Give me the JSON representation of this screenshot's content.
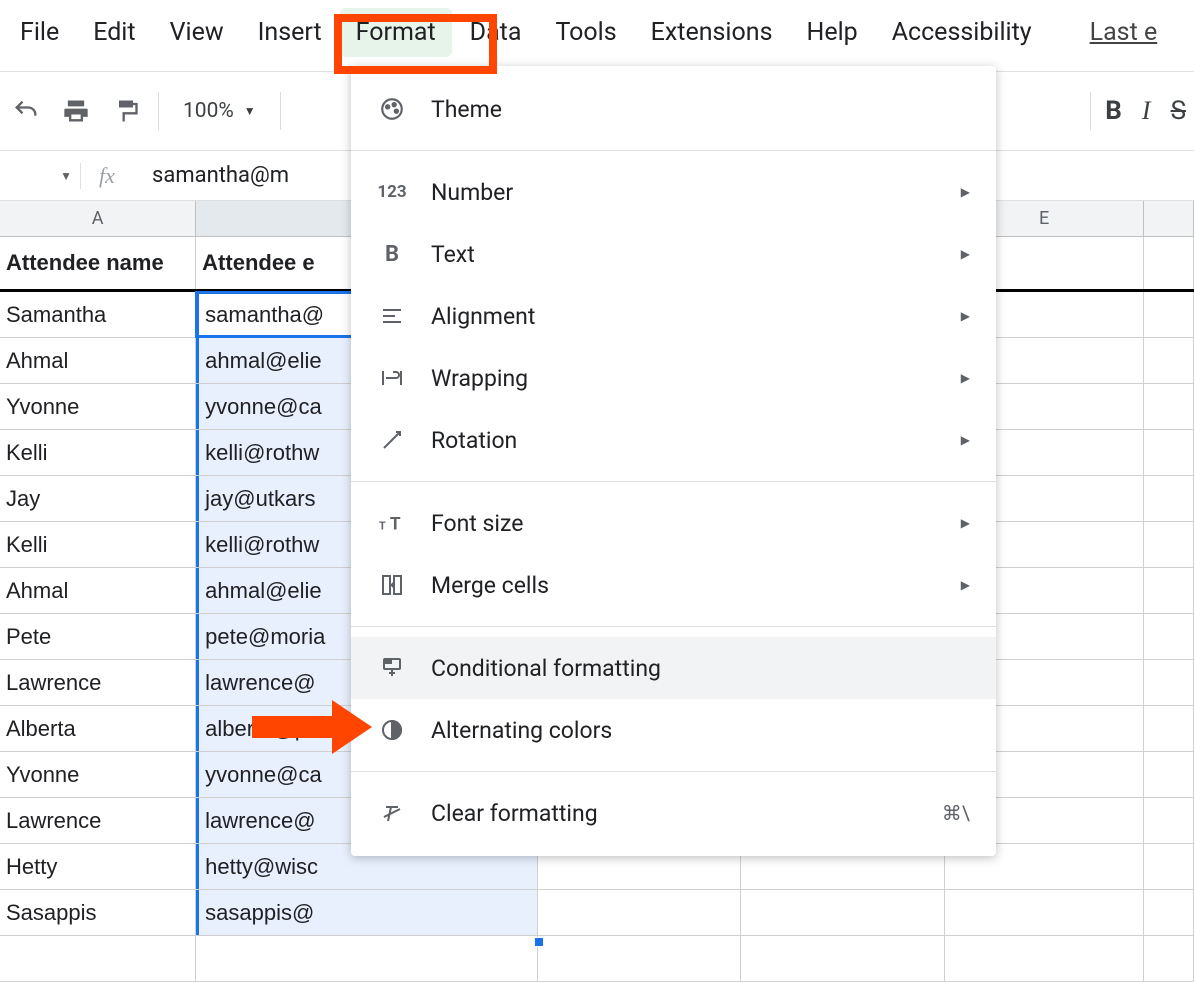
{
  "menubar": {
    "file": "File",
    "edit": "Edit",
    "view": "View",
    "insert": "Insert",
    "format": "Format",
    "data": "Data",
    "tools": "Tools",
    "extensions": "Extensions",
    "help": "Help",
    "accessibility": "Accessibility",
    "last_edit": "Last e"
  },
  "toolbar": {
    "zoom": "100%"
  },
  "formula_bar": {
    "fx": "fx",
    "value": "samantha@m"
  },
  "columns": {
    "a": "A",
    "b": "",
    "c": "",
    "d": "",
    "e": "E",
    "f": ""
  },
  "headers": {
    "name": "Attendee name",
    "email": "Attendee e"
  },
  "rows": [
    {
      "name": "Samantha",
      "email": "samantha@"
    },
    {
      "name": "Ahmal",
      "email": "ahmal@elie"
    },
    {
      "name": "Yvonne",
      "email": "yvonne@ca"
    },
    {
      "name": "Kelli",
      "email": "kelli@rothw"
    },
    {
      "name": "Jay",
      "email": "jay@utkars"
    },
    {
      "name": "Kelli",
      "email": "kelli@rothw"
    },
    {
      "name": "Ahmal",
      "email": "ahmal@elie"
    },
    {
      "name": "Pete",
      "email": "pete@moria"
    },
    {
      "name": "Lawrence",
      "email": "lawrence@"
    },
    {
      "name": "Alberta",
      "email": "alberta@pi"
    },
    {
      "name": "Yvonne",
      "email": "yvonne@ca"
    },
    {
      "name": "Lawrence",
      "email": "lawrence@"
    },
    {
      "name": "Hetty",
      "email": "hetty@wisc"
    },
    {
      "name": "Sasappis",
      "email": "sasappis@"
    }
  ],
  "menu": {
    "theme": "Theme",
    "number": "Number",
    "text": "Text",
    "alignment": "Alignment",
    "wrapping": "Wrapping",
    "rotation": "Rotation",
    "font_size": "Font size",
    "merge_cells": "Merge cells",
    "conditional_formatting": "Conditional formatting",
    "alternating_colors": "Alternating colors",
    "clear_formatting": "Clear formatting",
    "clear_shortcut": "⌘\\"
  }
}
